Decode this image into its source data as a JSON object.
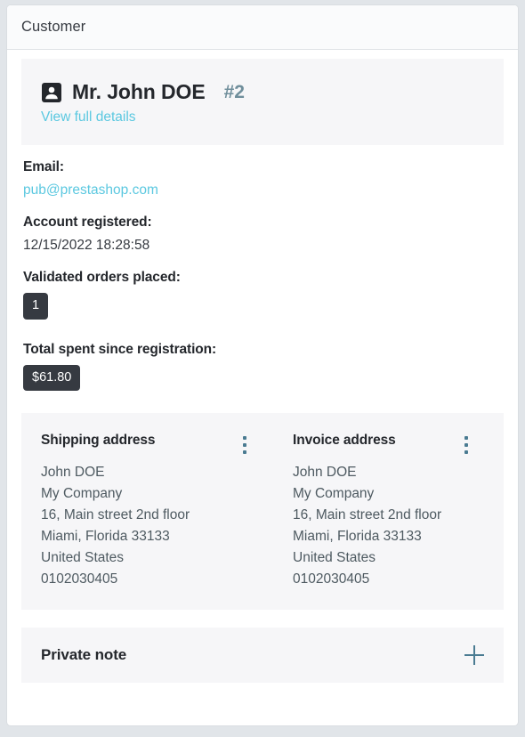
{
  "panel": {
    "header_title": "Customer"
  },
  "customer": {
    "icon": "contact-card-icon",
    "name": "Mr. John DOE",
    "id_label": "#2",
    "details_link": "View full details"
  },
  "details": [
    {
      "label": "Email:",
      "value": "pub@prestashop.com",
      "kind": "link"
    },
    {
      "label": "Account registered:",
      "value": "12/15/2022 18:28:58",
      "kind": "text"
    },
    {
      "label": "Validated orders placed:",
      "value": "1",
      "kind": "badge"
    },
    {
      "label": "Total spent since registration:",
      "value": "$61.80",
      "kind": "badge"
    }
  ],
  "addresses": {
    "shipping": {
      "title": "Shipping address",
      "menu_icon": "kebab-menu-icon",
      "lines": [
        "John DOE",
        "My Company",
        "16, Main street 2nd floor",
        "Miami, Florida 33133",
        "United States",
        "0102030405"
      ]
    },
    "invoice": {
      "title": "Invoice address",
      "menu_icon": "kebab-menu-icon",
      "lines": [
        "John DOE",
        "My Company",
        "16, Main street 2nd floor",
        "Miami, Florida 33133",
        "United States",
        "0102030405"
      ]
    }
  },
  "private_note": {
    "title": "Private note",
    "expand_icon": "plus-icon"
  },
  "colors": {
    "page_background": "#e1e5e9",
    "card_background": "#ffffff",
    "panel_background": "#f6f6f8",
    "header_background": "#fafbfc",
    "text_primary": "#24272c",
    "text_secondary": "#4e5a61",
    "link": "#5bc8e0",
    "customer_id": "#6f8e9b",
    "badge_background": "#363a41",
    "icon_accent": "#4a7b92"
  }
}
